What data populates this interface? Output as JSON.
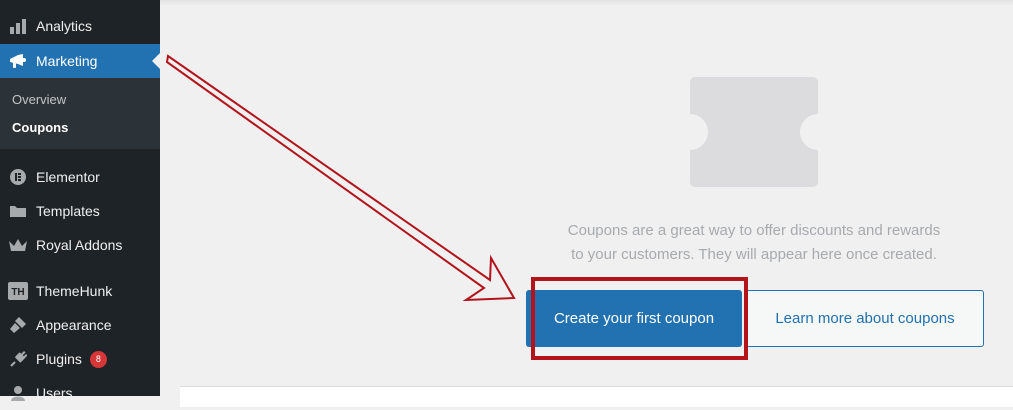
{
  "sidebar": {
    "items": [
      {
        "label": "Analytics",
        "icon": "bar-chart-icon"
      },
      {
        "label": "Marketing",
        "icon": "megaphone-icon",
        "active": true
      },
      {
        "label": "Elementor",
        "icon": "elementor-icon"
      },
      {
        "label": "Templates",
        "icon": "folder-icon"
      },
      {
        "label": "Royal Addons",
        "icon": "crown-icon"
      },
      {
        "label": "ThemeHunk",
        "icon": "themehunk-icon"
      },
      {
        "label": "Appearance",
        "icon": "paintbrush-icon"
      },
      {
        "label": "Plugins",
        "icon": "plug-icon",
        "badge": "8"
      },
      {
        "label": "Users",
        "icon": "users-icon"
      }
    ],
    "submenu": [
      {
        "label": "Overview"
      },
      {
        "label": "Coupons",
        "current": true
      }
    ],
    "themehunk_icon_text": "TH"
  },
  "empty_state": {
    "line1": "Coupons are a great way to offer discounts and rewards",
    "line2": "to your customers. They will appear here once created.",
    "primary_button": "Create your first coupon",
    "secondary_button": "Learn more about coupons"
  },
  "colors": {
    "sidebar_bg": "#1d2327",
    "accent": "#2271b1",
    "annotation_red": "#b3141c",
    "badge_red": "#d63638"
  }
}
